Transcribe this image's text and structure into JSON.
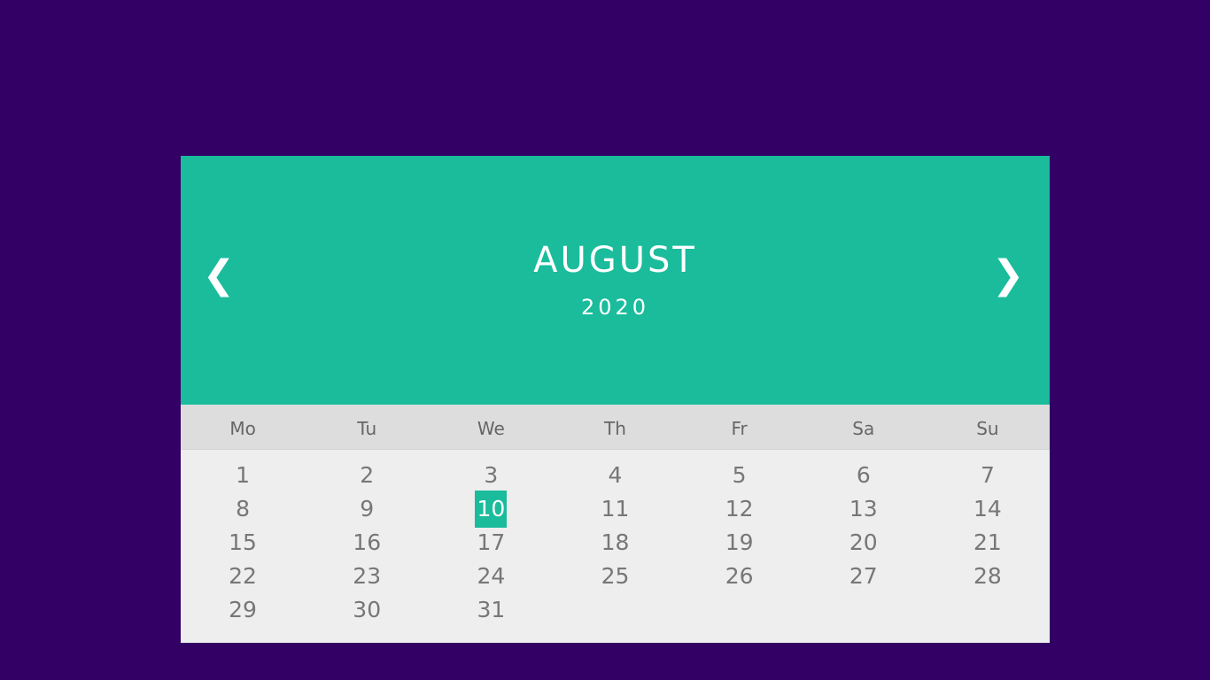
{
  "calendar": {
    "nav": {
      "prev": "❮",
      "next": "❯"
    },
    "month": "AUGUST",
    "year": "2020",
    "weekdays": [
      "Mo",
      "Tu",
      "We",
      "Th",
      "Fr",
      "Sa",
      "Su"
    ],
    "days": [
      "1",
      "2",
      "3",
      "4",
      "5",
      "6",
      "7",
      "8",
      "9",
      "10",
      "11",
      "12",
      "13",
      "14",
      "15",
      "16",
      "17",
      "18",
      "19",
      "20",
      "21",
      "22",
      "23",
      "24",
      "25",
      "26",
      "27",
      "28",
      "29",
      "30",
      "31"
    ],
    "active_day": "10",
    "colors": {
      "background": "#330066",
      "accent": "#1abc9c"
    }
  }
}
